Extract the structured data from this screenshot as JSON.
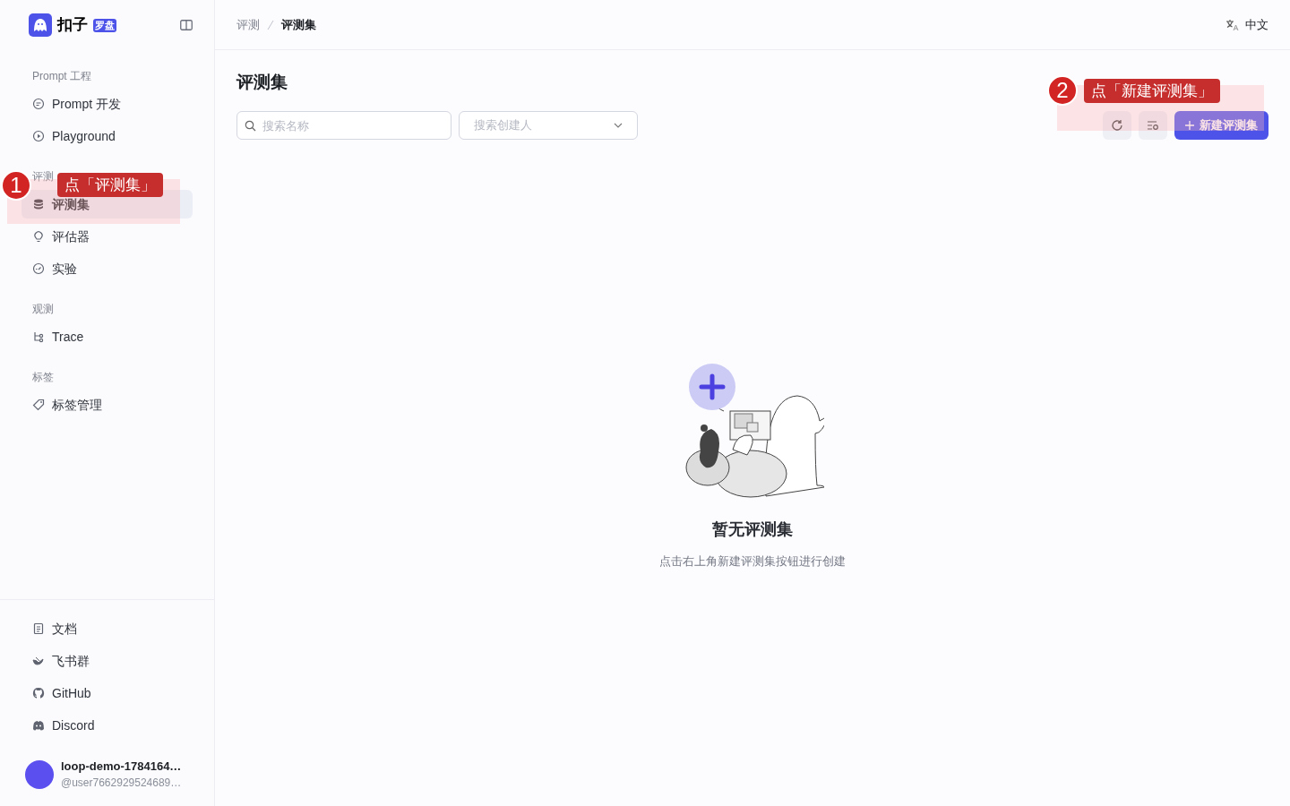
{
  "sidebar": {
    "logo_text": "扣子",
    "logo_badge": "罗盘",
    "sections": [
      {
        "title": "Prompt 工程",
        "items": [
          {
            "label": "Prompt 开发",
            "selected": false
          },
          {
            "label": "Playground",
            "selected": false
          }
        ]
      },
      {
        "title": "评测",
        "items": [
          {
            "label": "评测集",
            "selected": true
          },
          {
            "label": "评估器",
            "selected": false
          },
          {
            "label": "实验",
            "selected": false
          }
        ]
      },
      {
        "title": "观测",
        "items": [
          {
            "label": "Trace",
            "selected": false
          }
        ]
      },
      {
        "title": "标签",
        "items": [
          {
            "label": "标签管理",
            "selected": false
          }
        ]
      }
    ],
    "footer_items": [
      "文档",
      "飞书群",
      "GitHub",
      "Discord"
    ],
    "user": {
      "name": "loop-demo-1784164…",
      "handle": "@user7662929524689…"
    }
  },
  "breadcrumb": [
    "评测",
    "评测集"
  ],
  "language": "中文",
  "page_title": "评测集",
  "search": {
    "placeholder": "搜索名称"
  },
  "creator_filter": {
    "placeholder": "搜索创建人"
  },
  "create_button": "新建评测集",
  "empty_state": {
    "title": "暂无评测集",
    "description": "点击右上角新建评测集按钮进行创建"
  },
  "callouts": [
    {
      "number": "1",
      "text": "点「评测集」"
    },
    {
      "number": "2",
      "text": "点「新建评测集」"
    }
  ]
}
